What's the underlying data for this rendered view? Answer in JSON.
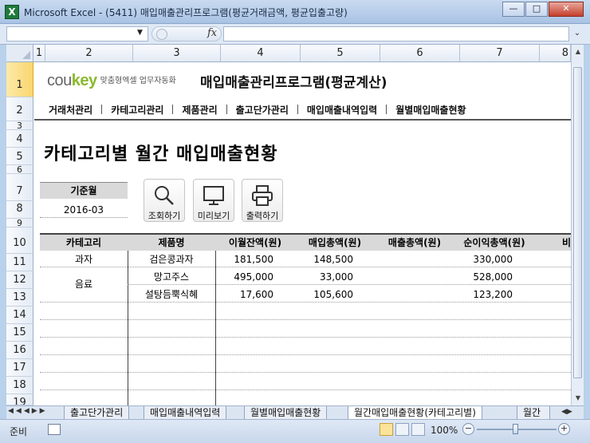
{
  "window": {
    "title": "Microsoft Excel - (5411) 매입매출관리프로그램(평균거래금액, 평균입출고량)",
    "min_label": "—",
    "max_label": "□",
    "close_label": "✕"
  },
  "formula_bar": {
    "fx_label": "fx",
    "name_box_arrow": "▼",
    "expand_arrow": "⌄"
  },
  "columns": [
    "1",
    "2",
    "3",
    "4",
    "5",
    "6",
    "7",
    "8"
  ],
  "rows": [
    "1",
    "2",
    "3",
    "4",
    "5",
    "6",
    "7",
    "8",
    "9",
    "10",
    "11",
    "12",
    "13",
    "14",
    "15",
    "16",
    "17",
    "18",
    "19"
  ],
  "brand": {
    "logo_prefix": "cou",
    "logo_suffix": "key",
    "tagline": "맞춤형엑셀 업무자동화"
  },
  "app_title": "매입매출관리프로그램(평균계산)",
  "menu": [
    "거래처관리",
    "카테고리관리",
    "제품관리",
    "출고단가관리",
    "매입매출내역입력",
    "월별매입매출현황"
  ],
  "section_title": "카테고리별 월간 매입매출현황",
  "month": {
    "label": "기준월",
    "value": "2016-03"
  },
  "buttons": {
    "search": "조회하기",
    "preview": "미리보기",
    "print": "출력하기"
  },
  "table": {
    "headers": [
      "카테고리",
      "제품명",
      "이월잔액(원)",
      "매입총액(원)",
      "매출총액(원)",
      "순이익총액(원)",
      "비"
    ],
    "rows": [
      {
        "category": "과자",
        "product": "검은콩과자",
        "carryover": "181,500",
        "purchase": "148,500",
        "sales": "",
        "profit": "330,000"
      },
      {
        "category": "음료",
        "product": "망고주스",
        "carryover": "495,000",
        "purchase": "33,000",
        "sales": "",
        "profit": "528,000"
      },
      {
        "category": "",
        "product": "설탕듬뿍식혜",
        "carryover": "17,600",
        "purchase": "105,600",
        "sales": "",
        "profit": "123,200"
      }
    ]
  },
  "sheet_tabs": [
    "출고단가관리",
    "매입매출내역입력",
    "월별매입매출현황",
    "월간매입매출현황(카테고리별)",
    "월간"
  ],
  "status": {
    "ready": "준비",
    "zoom": "100%",
    "zoom_minus": "−",
    "zoom_plus": "+"
  },
  "colors": {
    "logo_green": "#8ab92d",
    "row_select": "#f9d66e",
    "excel_green": "#1e7b3c"
  }
}
